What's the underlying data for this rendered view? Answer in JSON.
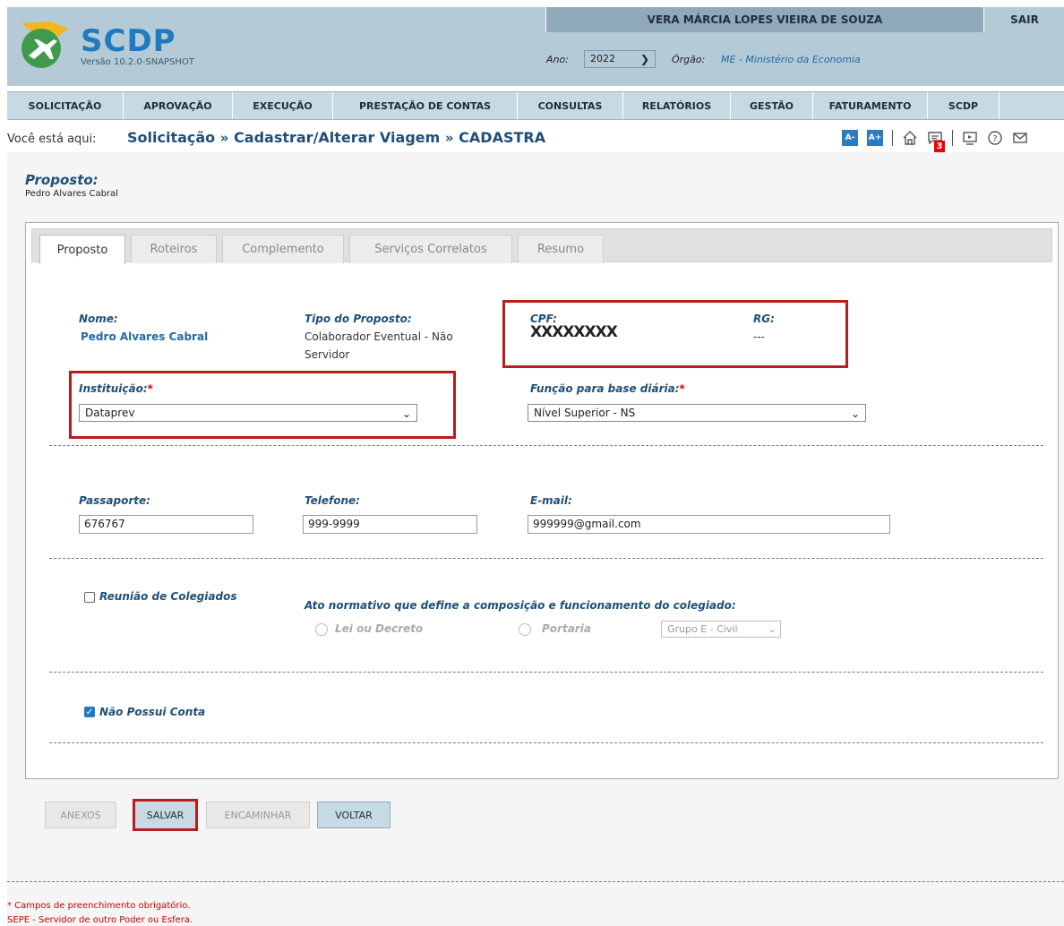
{
  "header": {
    "brand": "SCDP",
    "version": "Versão 10.2.0-SNAPSHOT",
    "user_name": "VERA MÁRCIA LOPES VIEIRA DE SOUZA",
    "logout_label": "SAIR",
    "year_label": "Ano:",
    "year_value": "2022",
    "org_label": "Órgão:",
    "org_value": "ME - Ministério da Economia"
  },
  "menu": {
    "items": [
      "SOLICITAÇÃO",
      "APROVAÇÃO",
      "EXECUÇÃO",
      "PRESTAÇÃO DE CONTAS",
      "CONSULTAS",
      "RELATÓRIOS",
      "GESTÃO",
      "FATURAMENTO",
      "SCDP"
    ]
  },
  "breadcrumb": {
    "prefix": "Você está aqui:",
    "parts": [
      "Solicitação",
      "Cadastrar/Alterar Viagem",
      "CADASTRA"
    ],
    "separator": "»"
  },
  "toolbar": {
    "font_decrease": "A-",
    "font_increase": "A+",
    "messages_count": "3"
  },
  "proposto": {
    "title": "Proposto:",
    "name": "Pedro Alvares Cabral"
  },
  "tabs": [
    "Proposto",
    "Roteiros",
    "Complemento",
    "Serviços Correlatos",
    "Resumo"
  ],
  "form": {
    "nome_label": "Nome:",
    "nome_value": "Pedro Alvares Cabral",
    "tipo_label": "Tipo do Proposto:",
    "tipo_value": "Colaborador Eventual - Não Servidor",
    "cpf_label": "CPF:",
    "cpf_value": "XXXXXXXX",
    "rg_label": "RG:",
    "rg_value": "---",
    "instituicao_label": "Instituição:",
    "instituicao_value": "Dataprev",
    "funcao_label": "Função para base diária:",
    "funcao_value": "Nível Superior - NS",
    "required_mark": "*",
    "passaporte_label": "Passaporte:",
    "passaporte_value": "676767",
    "telefone_label": "Telefone:",
    "telefone_value": "999-9999",
    "email_label": "E-mail:",
    "email_value": "999999@gmail.com",
    "reuniao_label": "Reunião de Colegiados",
    "reuniao_checked": false,
    "ato_label": "Ato normativo que define a composição e funcionamento do colegiado:",
    "lei_label": "Lei ou Decreto",
    "portaria_label": "Portaria",
    "grupo_value": "Grupo E - Civil",
    "conta_label": "Não Possui Conta",
    "conta_checked": true
  },
  "buttons": {
    "anexos": "ANEXOS",
    "salvar": "SALVAR",
    "encaminhar": "ENCAMINHAR",
    "voltar": "VOLTAR"
  },
  "notes": {
    "line1": "* Campos de preenchimento obrigatório.",
    "line2": "SEPE - Servidor de outro Poder ou Esfera."
  },
  "colors": {
    "header_bg": "#b4cad6",
    "menu_bg": "#c7d9e3",
    "brand_blue": "#1f7ac0",
    "label_blue": "#1f4f78",
    "highlight_red": "#b81d1d"
  }
}
